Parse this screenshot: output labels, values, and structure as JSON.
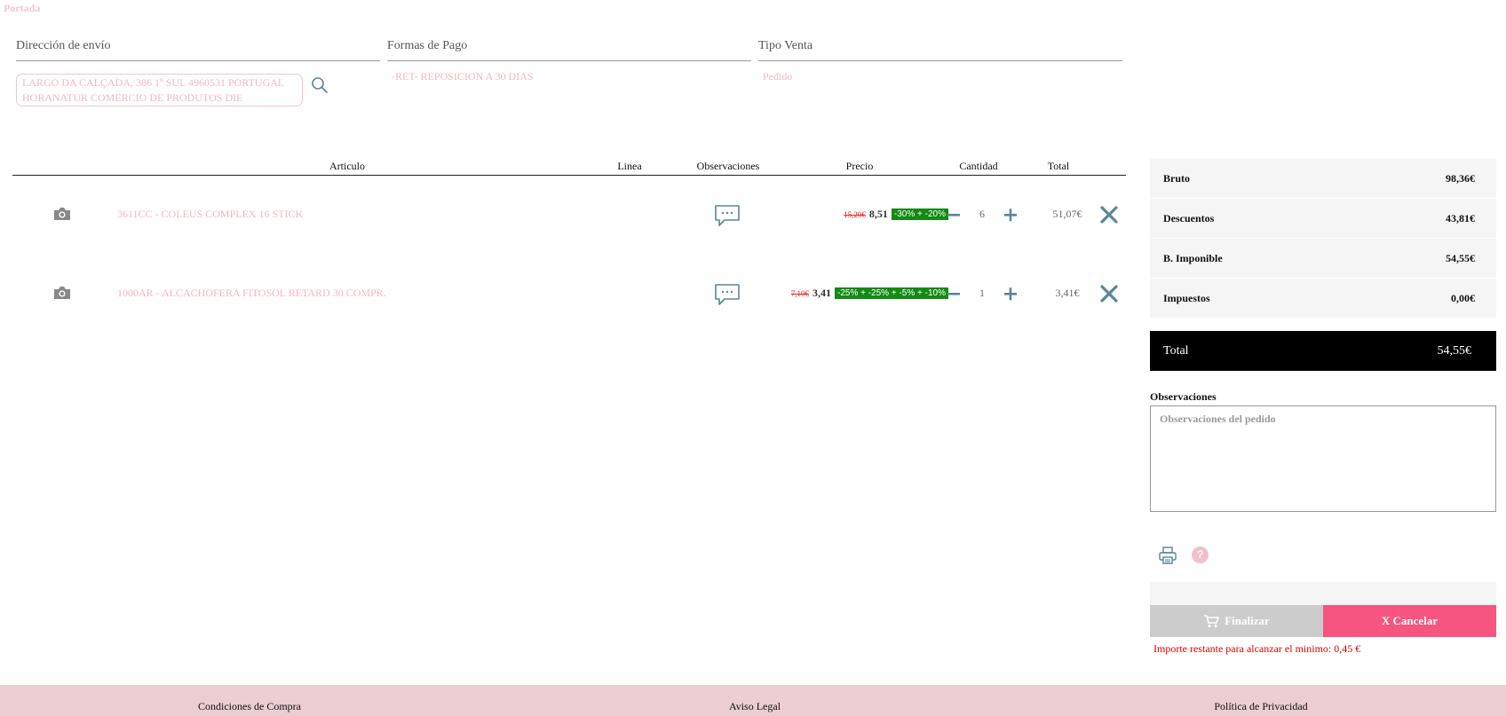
{
  "breadcrumb": "Portada",
  "fields": {
    "address": {
      "label": "Dirección de envío",
      "value": "LARGO DA CALÇADA, 386 1º SUL 4960531 PORTUGAL HORANATUR COMERCIO DE PRODUTOS DIE"
    },
    "payment": {
      "label": "Formas de Pago",
      "value": "-RET- REPOSICION A 30 DIAS"
    },
    "sale_type": {
      "label": "Tipo Venta",
      "value": "Pedido"
    }
  },
  "table": {
    "headers": {
      "article": "Articulo",
      "line": "Linea",
      "notes": "Observaciones",
      "price": "Precio",
      "quantity": "Cantidad",
      "total": "Total"
    },
    "rows": [
      {
        "description": "3611CC - COLEUS COMPLEX 16 STICK",
        "old_price": "15,20€",
        "price": "8,51",
        "discount": "-30% + -20%",
        "quantity": "6",
        "total": "51,07€"
      },
      {
        "description": "1000AR - ALCACHOFERA FITOSOL RETARD 30 COMPR.",
        "old_price": "7,10€",
        "price": "3,41",
        "discount": "-25% + -25% + -5% + -10%",
        "quantity": "1",
        "total": "3,41€"
      }
    ]
  },
  "summary": {
    "gross": {
      "label": "Bruto",
      "value": "98,36€"
    },
    "discounts": {
      "label": "Descuentos",
      "value": "43,81€"
    },
    "taxable": {
      "label": "B. Imponible",
      "value": "54,55€"
    },
    "taxes": {
      "label": "Impuestos",
      "value": "0,00€"
    },
    "total": {
      "label": "Total",
      "value": "54,55€"
    }
  },
  "notes": {
    "label": "Observaciones",
    "placeholder": "Observaciones del pedido"
  },
  "help_glyph": "?",
  "actions": {
    "finalize": "Finalizar",
    "cancel": "X Cancelar"
  },
  "warning": "Importe restante para alcanzar el minimo: 0,45 €",
  "footer": {
    "conditions": "Condiciones de Compra",
    "legal": "Aviso Legal",
    "privacy": "Política de Privacidad"
  },
  "colors": {
    "accent": "#f6557f",
    "discount_badge": "#138a13",
    "icon": "#5a8595",
    "footer_bg": "#ebcdd2"
  }
}
